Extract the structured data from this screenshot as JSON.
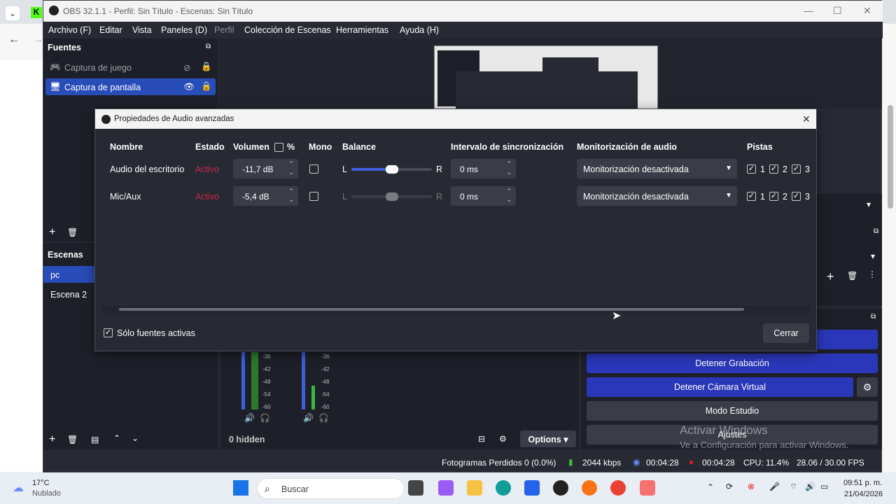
{
  "window_title": "OBS 32.1.1 - Perfil: Sin Título - Escenas: Sin Título",
  "menu": [
    "Archivo (F)",
    "Editar",
    "Vista",
    "Paneles (D)",
    "Perfil",
    "Colección de Escenas",
    "Herramientas",
    "Ayuda (H)"
  ],
  "sources": {
    "title": "Fuentes",
    "items": [
      {
        "label": "Captura de juego",
        "visible": false
      },
      {
        "label": "Captura de pantalla",
        "visible": true
      }
    ]
  },
  "scenes": {
    "title": "Escenas",
    "items": [
      "pc",
      "Escena 2"
    ]
  },
  "dialog": {
    "title": "Propiedades de Audio avanzadas",
    "headers": {
      "name": "Nombre",
      "status": "Estado",
      "volume": "Volumen",
      "percent": "%",
      "mono": "Mono",
      "balance": "Balance",
      "sync": "Intervalo de sincronización",
      "monitor": "Monitorización de audio",
      "tracks": "Pistas"
    },
    "rows": [
      {
        "name": "Audio del escritorio",
        "status": "Activo",
        "volume": "-11,7 dB",
        "sync": "0 ms",
        "monitor": "Monitorización desactivada",
        "balance": 0.5,
        "balance_l": "L",
        "balance_r": "R",
        "tracks": [
          "1",
          "2",
          "3"
        ]
      },
      {
        "name": "Mic/Aux",
        "status": "Activo",
        "volume": "-5,4 dB",
        "sync": "0 ms",
        "monitor": "Monitorización desactivada",
        "balance": 0.5,
        "balance_l": "L",
        "balance_r": "R",
        "tracks": [
          "1",
          "2",
          "3"
        ]
      }
    ],
    "only_active_label": "Sólo fuentes activas",
    "close_label": "Cerrar"
  },
  "mixer": {
    "scale": [
      "-36",
      "-42",
      "-48",
      "-54",
      "-60"
    ],
    "hidden_label": "0 hidden",
    "options_label": "Options"
  },
  "controls": {
    "stop_recording": "Detener Grabación",
    "stop_virtual_cam": "Detener Cámara Virtual",
    "studio_mode": "Modo Estudio",
    "settings": "Ajustes"
  },
  "watermark": {
    "line1": "Activar Windows",
    "line2": "Ve a Configuración para activar Windows."
  },
  "statusbar": {
    "dropped": "Fotogramas Perdidos 0 (0.0%)",
    "bitrate": "2044 kbps",
    "stream_time": "00:04:28",
    "rec_time": "00:04:28",
    "cpu": "CPU: 11.4%",
    "fps": "28.06 / 30.00 FPS"
  },
  "taskbar": {
    "temp": "17°C",
    "weather": "Nublado",
    "search": "Buscar",
    "time": "09:51 p. m.",
    "date": "21/04/2026"
  },
  "colors": {
    "accent_blue": "#2a37b8",
    "selected": "#284cb8",
    "active_red": "#c7284a"
  }
}
